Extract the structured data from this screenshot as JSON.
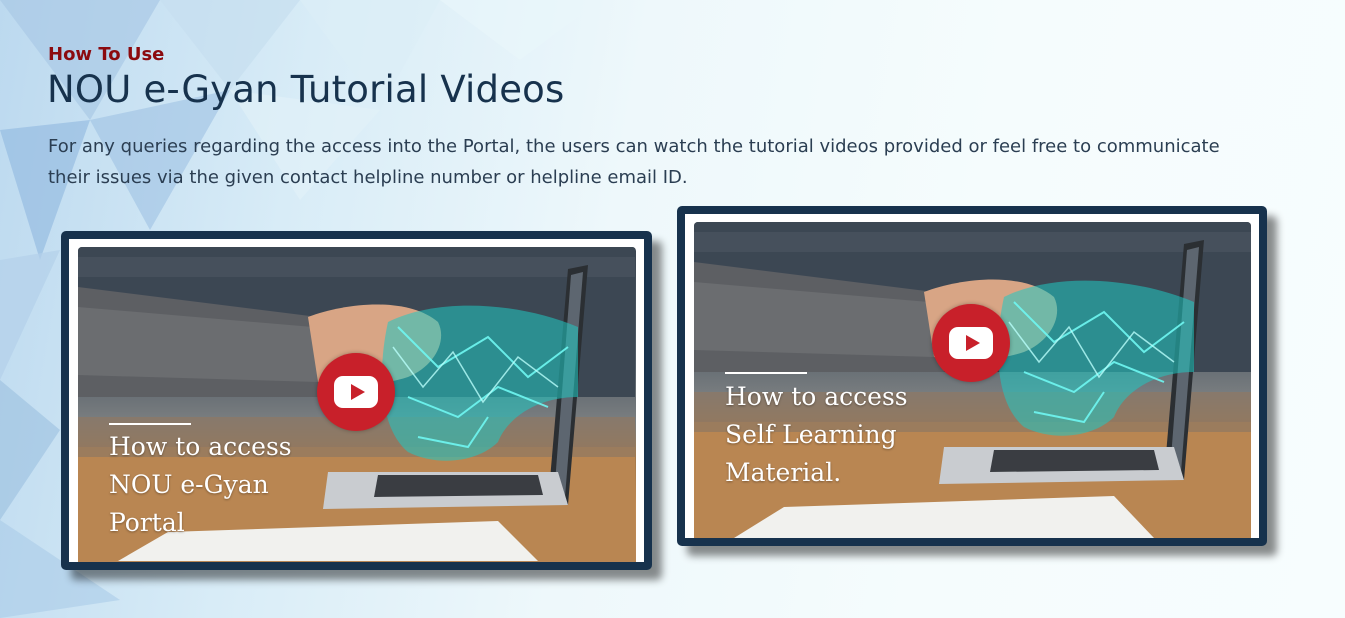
{
  "section": {
    "label": "How To Use",
    "title": "NOU e-Gyan Tutorial Videos",
    "description": "For any queries regarding the access into the Portal, the users can watch the tutorial videos provided or feel free to communicate their issues via the given contact helpline number or helpline email ID."
  },
  "videos": [
    {
      "caption_lines": [
        "How to access",
        "NOU e-Gyan",
        "Portal"
      ],
      "icon": "youtube-play-icon"
    },
    {
      "caption_lines": [
        "How to access",
        "Self Learning",
        "Material."
      ],
      "icon": "youtube-play-icon"
    }
  ],
  "colors": {
    "label": "#8b0a0f",
    "title": "#17324d",
    "card_frame": "#17324d",
    "play_button": "#c8202a",
    "hologram_hand": "#2fe6e0"
  }
}
